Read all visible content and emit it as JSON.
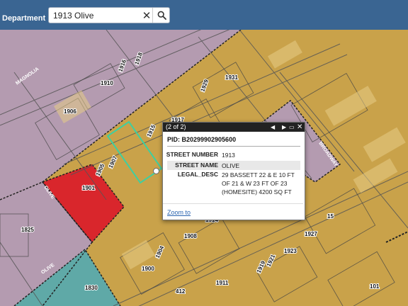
{
  "header": {
    "department_label": "Department"
  },
  "search": {
    "value": "1913 Olive"
  },
  "icons": {
    "clear": "close-icon",
    "search": "search-icon"
  },
  "colors": {
    "header_bg": "#3a6592",
    "zone_orange": "#c9a24a",
    "zone_purple": "#b49bb0",
    "zone_red": "#d9262c",
    "zone_teal": "#5fa9a7",
    "selected_outline": "#3fcfa0"
  },
  "map": {
    "lot_labels": [
      "1918",
      "1916",
      "1910",
      "1931",
      "1929",
      "1906",
      "1917",
      "1915",
      "1907",
      "1905",
      "1901",
      "1914",
      "1908",
      "1904",
      "1900",
      "1927",
      "1923",
      "1921",
      "1919",
      "1911",
      "412",
      "1825",
      "15",
      "101",
      "1830"
    ],
    "street_labels": [
      "MAGNOLIA",
      "OLIVE",
      "OLIVE",
      "BROADWAY"
    ]
  },
  "popup": {
    "count": "(2 of 2)",
    "pid": "PID: B20299902905600",
    "fields": [
      {
        "key": "STREET NUMBER",
        "value": "1913"
      },
      {
        "key": "STREET NAME",
        "value": "OLIVE"
      },
      {
        "key": "LEGAL_DESC",
        "value": "29 BASSETT 22 & E 10 FT OF 21 & W 23 FT OF 23 (HOMESITE) 4200 SQ FT"
      }
    ],
    "zoom_link": "Zoom to"
  }
}
